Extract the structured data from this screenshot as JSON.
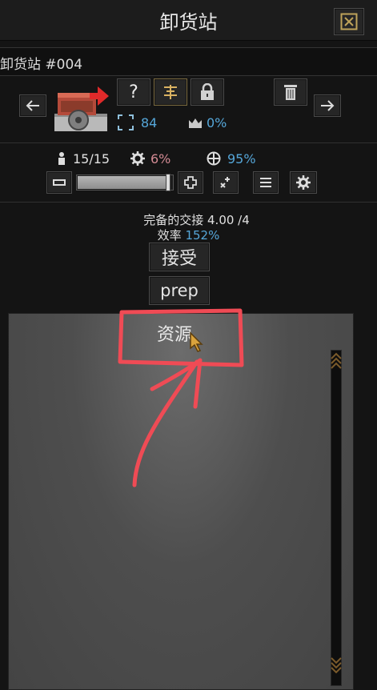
{
  "window": {
    "title": "卸货站"
  },
  "building": {
    "name": "卸货站 #004"
  },
  "stats": {
    "range": "84",
    "percent_owned": "0%"
  },
  "workers": {
    "count": "15/15",
    "gear_percent": "6%",
    "target_percent": "95%",
    "slider_fraction": 0.97
  },
  "status": {
    "completed_label": "完备的交接",
    "completed_value": "4.00 /4",
    "efficiency_label": "效率",
    "efficiency_value": "152%"
  },
  "buttons": {
    "accept": "接受",
    "prep": "prep",
    "help": "?"
  },
  "resources": {
    "header": "资源"
  },
  "colors": {
    "accent_blue": "#55a6d8",
    "gear_pink": "#d28a93",
    "annotation_red": "#ef4b55"
  }
}
